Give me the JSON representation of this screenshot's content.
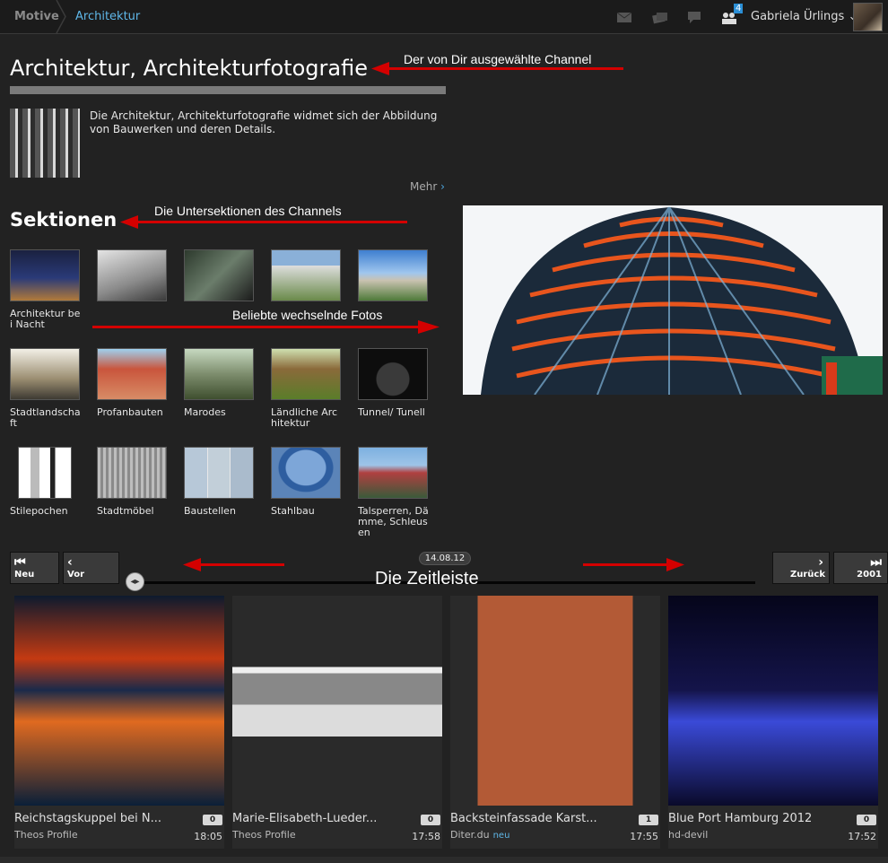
{
  "breadcrumb": {
    "home": "Motive",
    "current": "Architektur"
  },
  "user": {
    "name": "Gabriela Ürlings",
    "notification_count": "4"
  },
  "channel": {
    "title": "Architektur, Architekturfotografie",
    "description": "Die Architektur, Architekturfotografie widmet sich der Abbildung von Bauwerken und deren Details.",
    "more_label": "Mehr"
  },
  "sections": {
    "title": "Sektionen",
    "items": [
      {
        "label": "Architektur bei Nacht"
      },
      {
        "label": ""
      },
      {
        "label": ""
      },
      {
        "label": ""
      },
      {
        "label": ""
      },
      {
        "label": "Stadtlandschaft"
      },
      {
        "label": "Profanbauten"
      },
      {
        "label": "Marodes"
      },
      {
        "label": "Ländliche Architektur"
      },
      {
        "label": "Tunnel/ Tunell"
      },
      {
        "label": "Stilepochen"
      },
      {
        "label": "Stadtmöbel"
      },
      {
        "label": "Baustellen"
      },
      {
        "label": "Stahlbau"
      },
      {
        "label": "Talsperren, Dämme, Schleusen"
      }
    ]
  },
  "annotations": {
    "channel": "Der von Dir ausgewählte Channel",
    "subsections": "Die Untersektionen des Channels",
    "popular": "Beliebte wechselnde Fotos",
    "timeline": "Die Zeitleiste"
  },
  "timeline": {
    "date": "14.08.12",
    "btn_newest": "Neu",
    "btn_prev": "Vor",
    "btn_next": "Zurück",
    "btn_oldest": "2001"
  },
  "photos": [
    {
      "title": "Reichstagskuppel bei N...",
      "author": "Theos Profile",
      "count": "0",
      "time": "18:05",
      "new": ""
    },
    {
      "title": "Marie-Elisabeth-Lueder...",
      "author": "Theos Profile",
      "count": "0",
      "time": "17:58",
      "new": ""
    },
    {
      "title": "Backsteinfassade Karst...",
      "author": "Diter.du",
      "count": "1",
      "time": "17:55",
      "new": "neu"
    },
    {
      "title": "Blue Port Hamburg 2012",
      "author": "hd-devil",
      "count": "0",
      "time": "17:52",
      "new": ""
    }
  ],
  "colors": {
    "accent": "#5fb7e8",
    "arrow": "#d40000",
    "background": "#222222"
  }
}
